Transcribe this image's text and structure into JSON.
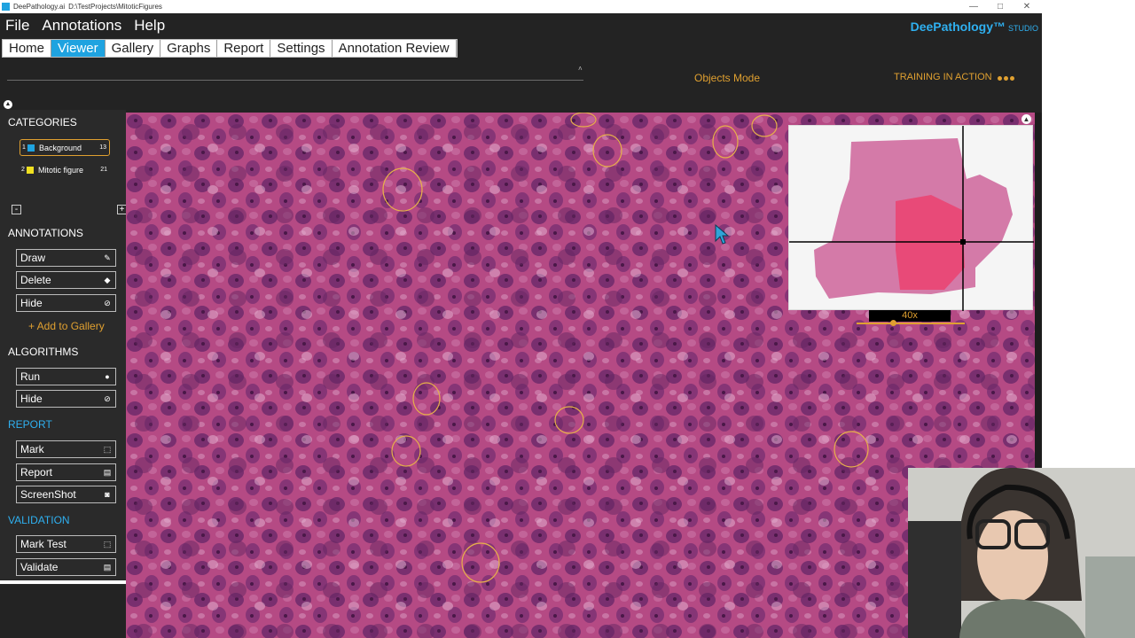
{
  "window": {
    "app_name": "DeePathology.ai",
    "path": "D:\\TestProjects\\MitoticFigures",
    "controls": [
      "—",
      "□",
      "✕"
    ]
  },
  "menu": [
    "File",
    "Annotations",
    "Help"
  ],
  "brand": {
    "name": "DeePathology™",
    "suffix": "STUDIO"
  },
  "tabs": [
    {
      "label": "Home",
      "active": false
    },
    {
      "label": "Viewer",
      "active": true
    },
    {
      "label": "Gallery",
      "active": false
    },
    {
      "label": "Graphs",
      "active": false
    },
    {
      "label": "Report",
      "active": false
    },
    {
      "label": "Settings",
      "active": false
    },
    {
      "label": "Annotation Review",
      "active": false
    }
  ],
  "status": {
    "mode": "Objects Mode",
    "training": "TRAINING IN ACTION"
  },
  "sidebar": {
    "categories_title": "CATEGORIES",
    "categories": [
      {
        "num": "1",
        "label": "Background",
        "count": "13",
        "color": "#1fa3e0",
        "selected": true
      },
      {
        "num": "2",
        "label": "Mitotic figure",
        "count": "21",
        "color": "#f0e020",
        "selected": false
      }
    ],
    "minus": "-",
    "plus": "+",
    "annotations_title": "ANNOTATIONS",
    "annotation_buttons": [
      {
        "label": "Draw",
        "icon": "pencil-icon"
      },
      {
        "label": "Delete",
        "icon": "eraser-icon"
      },
      {
        "label": "Hide",
        "icon": "eye-slash-icon"
      }
    ],
    "add_to_gallery": "+ Add to Gallery",
    "algorithms_title": "ALGORITHMS",
    "algorithm_buttons": [
      {
        "label": "Run",
        "icon": "play-circle-icon"
      },
      {
        "label": "Hide",
        "icon": "eye-slash-icon"
      }
    ],
    "report_title": "REPORT",
    "report_buttons": [
      {
        "label": "Mark",
        "icon": "square-icon"
      },
      {
        "label": "Report",
        "icon": "document-icon"
      },
      {
        "label": "ScreenShot",
        "icon": "camera-icon"
      }
    ],
    "validation_title": "VALIDATION",
    "validation_buttons": [
      {
        "label": "Mark Test",
        "icon": "square-icon"
      },
      {
        "label": "Validate",
        "icon": "document-icon"
      }
    ]
  },
  "overview": {
    "zoom": "40x"
  },
  "colors": {
    "accent": "#1fa3e0",
    "orange": "#e0a030",
    "tissue": "#b0467e"
  }
}
